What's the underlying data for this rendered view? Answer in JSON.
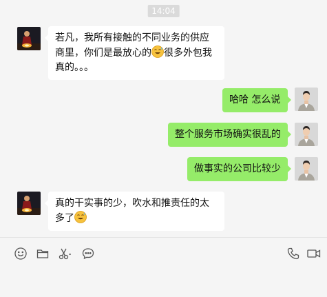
{
  "timestamp": "14:04",
  "messages": [
    {
      "sender": "contact",
      "avatar": "contact-avatar",
      "parts": [
        "若凡，我所有接触的不同业务的供应商里，你们是最放心的",
        "很多外包我真的。。。"
      ],
      "emoji": "sweat-smile-emoji"
    },
    {
      "sender": "self",
      "avatar": "self-avatar",
      "text": "哈哈 怎么说"
    },
    {
      "sender": "self",
      "avatar": "self-avatar",
      "text": "整个服务市场确实很乱的"
    },
    {
      "sender": "self",
      "avatar": "self-avatar",
      "text": "做事实的公司比较少"
    },
    {
      "sender": "contact",
      "avatar": "contact-avatar",
      "parts": [
        "真的干实事的少，吹水和推责任的太多了",
        ""
      ],
      "emoji": "sweat-smile-emoji"
    }
  ],
  "toolbar": {
    "left": [
      "smiley-icon",
      "folder-icon",
      "scissors-icon",
      "chat-bubble-icon"
    ],
    "right": [
      "phone-icon",
      "video-camera-icon"
    ]
  },
  "colors": {
    "background": "#f5f5f5",
    "self_bubble": "#95ec69",
    "contact_bubble": "#ffffff",
    "timestamp_bg": "#dadada"
  }
}
